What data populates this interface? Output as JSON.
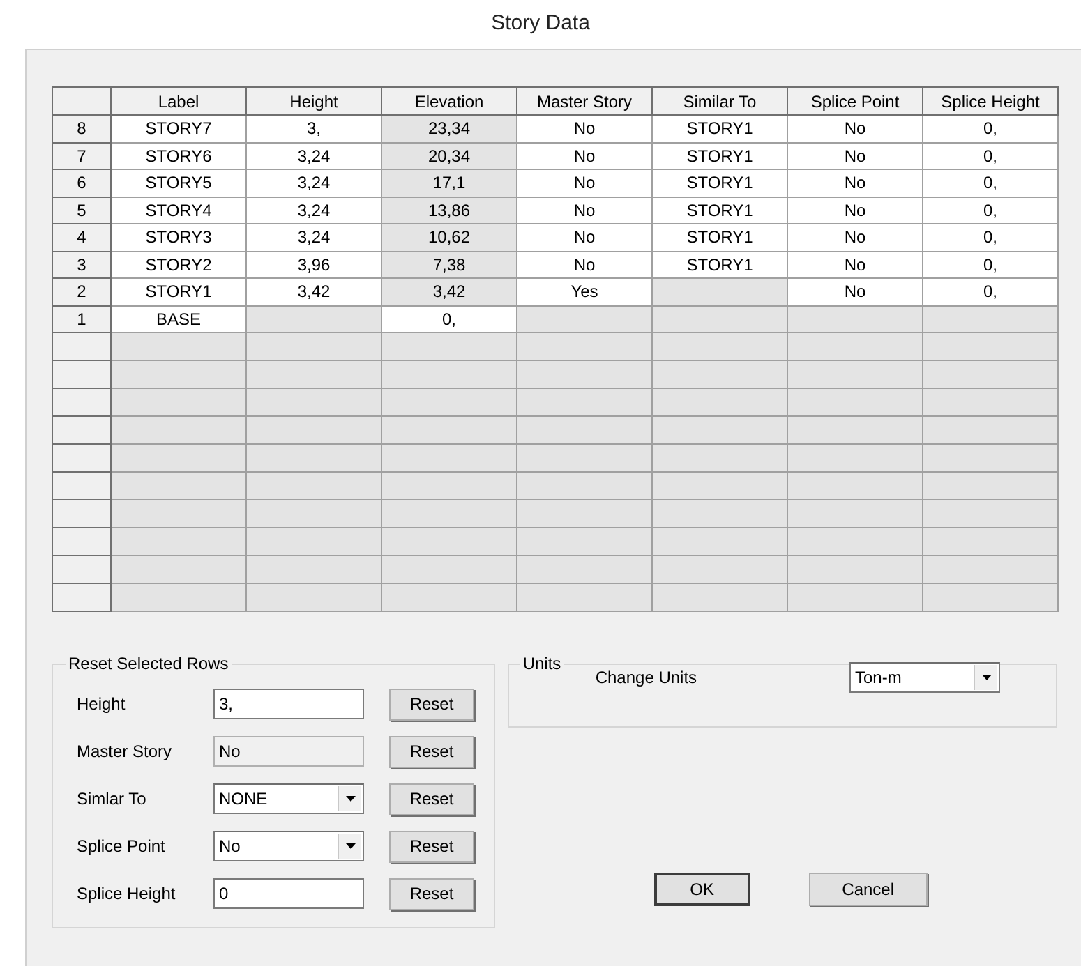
{
  "window": {
    "title": "Story Data"
  },
  "table": {
    "columns": [
      "Label",
      "Height",
      "Elevation",
      "Master Story",
      "Similar To",
      "Splice Point",
      "Splice Height"
    ],
    "rows": [
      {
        "number": "8",
        "cells": [
          {
            "text": "STORY7",
            "editable": true
          },
          {
            "text": "3,",
            "editable": true
          },
          {
            "text": "23,34",
            "editable": false
          },
          {
            "text": "No",
            "editable": true
          },
          {
            "text": "STORY1",
            "editable": true
          },
          {
            "text": "No",
            "editable": true
          },
          {
            "text": "0,",
            "editable": true
          }
        ]
      },
      {
        "number": "7",
        "cells": [
          {
            "text": "STORY6",
            "editable": true
          },
          {
            "text": "3,24",
            "editable": true
          },
          {
            "text": "20,34",
            "editable": false
          },
          {
            "text": "No",
            "editable": true
          },
          {
            "text": "STORY1",
            "editable": true
          },
          {
            "text": "No",
            "editable": true
          },
          {
            "text": "0,",
            "editable": true
          }
        ]
      },
      {
        "number": "6",
        "cells": [
          {
            "text": "STORY5",
            "editable": true
          },
          {
            "text": "3,24",
            "editable": true
          },
          {
            "text": "17,1",
            "editable": false
          },
          {
            "text": "No",
            "editable": true
          },
          {
            "text": "STORY1",
            "editable": true
          },
          {
            "text": "No",
            "editable": true
          },
          {
            "text": "0,",
            "editable": true
          }
        ]
      },
      {
        "number": "5",
        "cells": [
          {
            "text": "STORY4",
            "editable": true
          },
          {
            "text": "3,24",
            "editable": true
          },
          {
            "text": "13,86",
            "editable": false
          },
          {
            "text": "No",
            "editable": true
          },
          {
            "text": "STORY1",
            "editable": true
          },
          {
            "text": "No",
            "editable": true
          },
          {
            "text": "0,",
            "editable": true
          }
        ]
      },
      {
        "number": "4",
        "cells": [
          {
            "text": "STORY3",
            "editable": true
          },
          {
            "text": "3,24",
            "editable": true
          },
          {
            "text": "10,62",
            "editable": false
          },
          {
            "text": "No",
            "editable": true
          },
          {
            "text": "STORY1",
            "editable": true
          },
          {
            "text": "No",
            "editable": true
          },
          {
            "text": "0,",
            "editable": true
          }
        ]
      },
      {
        "number": "3",
        "cells": [
          {
            "text": "STORY2",
            "editable": true
          },
          {
            "text": "3,96",
            "editable": true
          },
          {
            "text": "7,38",
            "editable": false
          },
          {
            "text": "No",
            "editable": true
          },
          {
            "text": "STORY1",
            "editable": true
          },
          {
            "text": "No",
            "editable": true
          },
          {
            "text": "0,",
            "editable": true
          }
        ]
      },
      {
        "number": "2",
        "cells": [
          {
            "text": "STORY1",
            "editable": true
          },
          {
            "text": "3,42",
            "editable": true
          },
          {
            "text": "3,42",
            "editable": false
          },
          {
            "text": "Yes",
            "editable": true
          },
          {
            "editable": false
          },
          {
            "text": "No",
            "editable": true
          },
          {
            "text": "0,",
            "editable": true
          }
        ]
      },
      {
        "number": "1",
        "cells": [
          {
            "text": "BASE",
            "editable": true
          },
          {
            "editable": false
          },
          {
            "text": "0,",
            "editable": true
          },
          {
            "editable": false
          },
          {
            "editable": false
          },
          {
            "editable": false
          },
          {
            "editable": false
          }
        ]
      }
    ]
  },
  "reset_group": {
    "title": "Reset Selected Rows",
    "fields": [
      {
        "kind": "text",
        "label": "Height",
        "value": "3,",
        "disabled": false,
        "button": "Reset"
      },
      {
        "kind": "text",
        "label": "Master Story",
        "value": "No",
        "disabled": true,
        "button": "Reset"
      },
      {
        "kind": "dropdown",
        "label": "Simlar To",
        "value": "NONE",
        "disabled": false,
        "button": "Reset"
      },
      {
        "kind": "dropdown",
        "label": "Splice Point",
        "value": "No",
        "disabled": false,
        "button": "Reset"
      },
      {
        "kind": "text",
        "label": "Splice Height",
        "value": "0",
        "disabled": false,
        "button": "Reset"
      }
    ]
  },
  "units_group": {
    "title": "Units",
    "label": "Change Units",
    "value": "Ton-m"
  },
  "buttons": [
    {
      "label": "OK",
      "default": true
    },
    {
      "label": "Cancel",
      "default": false
    }
  ]
}
